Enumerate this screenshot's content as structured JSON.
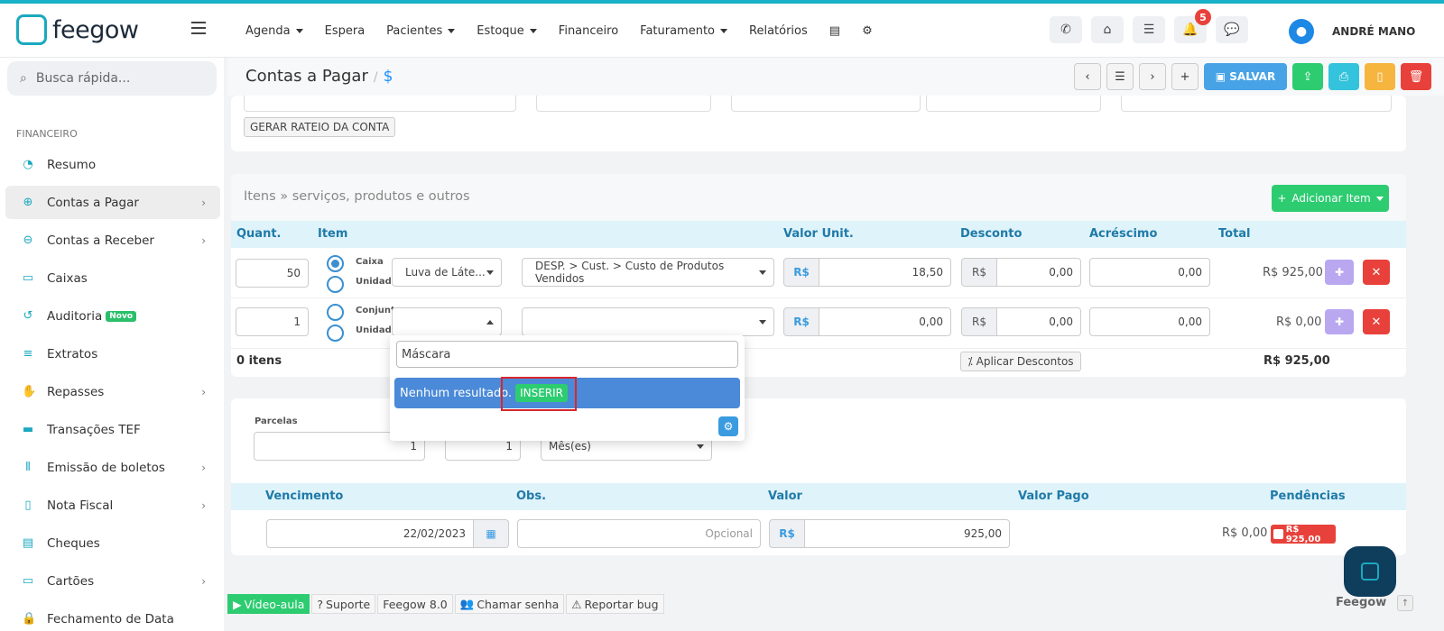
{
  "brand": {
    "name": "feegow"
  },
  "menu": [
    {
      "label": "Agenda",
      "caret": true
    },
    {
      "label": "Espera",
      "caret": false
    },
    {
      "label": "Pacientes",
      "caret": true
    },
    {
      "label": "Estoque",
      "caret": true
    },
    {
      "label": "Financeiro",
      "caret": false
    },
    {
      "label": "Faturamento",
      "caret": true
    },
    {
      "label": "Relatórios",
      "caret": false
    }
  ],
  "header": {
    "notif_count": "5",
    "user_name": "ANDRÉ MANO"
  },
  "sidebar": {
    "search_placeholder": "Busca rápida...",
    "section": "FINANCEIRO",
    "items": [
      {
        "label": "Resumo",
        "icon": "pie-chart-icon",
        "chev": false,
        "active": false
      },
      {
        "label": "Contas a Pagar",
        "icon": "arrow-up-circle-icon",
        "chev": true,
        "active": true
      },
      {
        "label": "Contas a Receber",
        "icon": "arrow-down-circle-icon",
        "chev": true,
        "active": false
      },
      {
        "label": "Caixas",
        "icon": "inbox-icon",
        "chev": false,
        "active": false
      },
      {
        "label": "Auditoria",
        "icon": "history-icon",
        "chev": false,
        "active": false,
        "badge": "Novo"
      },
      {
        "label": "Extratos",
        "icon": "list-icon",
        "chev": false,
        "active": false
      },
      {
        "label": "Repasses",
        "icon": "hand-money-icon",
        "chev": true,
        "active": false
      },
      {
        "label": "Transações TEF",
        "icon": "card-icon",
        "chev": false,
        "active": false
      },
      {
        "label": "Emissão de boletos",
        "icon": "barcode-icon",
        "chev": true,
        "active": false
      },
      {
        "label": "Nota Fiscal",
        "icon": "document-icon",
        "chev": true,
        "active": false
      },
      {
        "label": "Cheques",
        "icon": "check-icon",
        "chev": false,
        "active": false
      },
      {
        "label": "Cartões",
        "icon": "credit-card-icon",
        "chev": true,
        "active": false
      },
      {
        "label": "Fechamento de Data",
        "icon": "lock-icon",
        "chev": false,
        "active": false
      }
    ]
  },
  "page": {
    "title": "Contas a Pagar",
    "title_icon": "$",
    "save_label": "SALVAR"
  },
  "rateio_label": "GERAR RATEIO DA CONTA",
  "items_section": {
    "title": "Itens » serviços, produtos e outros",
    "add_label": "Adicionar Item",
    "columns": [
      "Quant.",
      "Item",
      "Valor Unit.",
      "Desconto",
      "Acréscimo",
      "Total"
    ],
    "rows": [
      {
        "qty": "50",
        "opt1": "Caixa",
        "opt2": "Unidade",
        "product": "Luva de Láte...",
        "category": "DESP. > Cust. > Custo de Produtos Vendidos",
        "currency": "R$",
        "unit": "18,50",
        "discount": "0,00",
        "increase": "0,00",
        "total": "R$ 925,00"
      },
      {
        "qty": "1",
        "opt1": "Conjunto",
        "opt2": "Unidade",
        "product": "",
        "category": "",
        "currency": "R$",
        "unit": "0,00",
        "discount": "0,00",
        "increase": "0,00",
        "total": "R$ 0,00"
      }
    ],
    "count_label": "0 itens",
    "apply_discounts": "Aplicar Descontos",
    "grand_total": "R$ 925,00"
  },
  "dropdown": {
    "search_value": "Máscara",
    "no_result": "Nenhum resultado.",
    "insert_label": "INSERIR"
  },
  "parcelas": {
    "label": "Parcelas",
    "value": "1",
    "interval": "1",
    "period": "Mês(es)"
  },
  "installments": {
    "columns": [
      "Vencimento",
      "Obs.",
      "Valor",
      "Valor Pago",
      "Pendências"
    ],
    "row": {
      "due": "22/02/2023",
      "obs_placeholder": "Opcional",
      "currency": "R$",
      "value": "925,00",
      "paid": "R$ 0,00",
      "pending": "R$ 925,00"
    }
  },
  "footer": {
    "video": "Vídeo-aula",
    "support": "Suporte",
    "version": "Feegow 8.0",
    "call": "Chamar senha",
    "bug": "Reportar bug",
    "brand": "Feegow"
  }
}
